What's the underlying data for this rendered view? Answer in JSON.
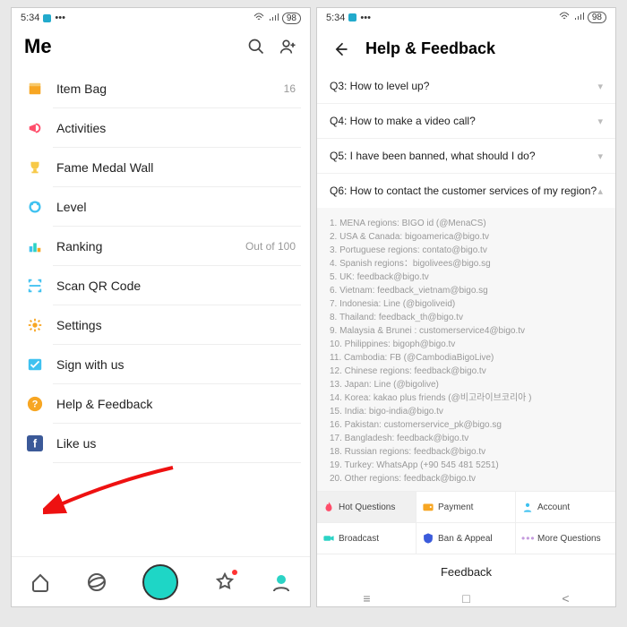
{
  "status": {
    "time": "5:34",
    "battery": "98",
    "dots": "•••"
  },
  "left": {
    "title": "Me",
    "items": [
      {
        "label": "Item Bag",
        "right": "16"
      },
      {
        "label": "Activities",
        "right": ""
      },
      {
        "label": "Fame Medal Wall",
        "right": ""
      },
      {
        "label": "Level",
        "right": ""
      },
      {
        "label": "Ranking",
        "right": "Out of 100"
      },
      {
        "label": "Scan QR Code",
        "right": ""
      },
      {
        "label": "Settings",
        "right": ""
      },
      {
        "label": "Sign with us",
        "right": ""
      },
      {
        "label": "Help & Feedback",
        "right": ""
      },
      {
        "label": "Like us",
        "right": ""
      }
    ]
  },
  "right": {
    "title": "Help & Feedback",
    "questions": [
      "Q3: How to level up?",
      "Q4: How to make a video call?",
      "Q5: I have been banned, what should I do?",
      "Q6: How to contact the customer services of my region?"
    ],
    "answer_lines": [
      "1. MENA regions: BIGO id (@MenaCS)",
      "2. USA & Canada: bigoamerica@bigo.tv",
      "3. Portuguese regions: contato@bigo.tv",
      "4. Spanish regions：bigolivees@bigo.sg",
      "5. UK: feedback@bigo.tv",
      "6. Vietnam: feedback_vietnam@bigo.sg",
      "7. Indonesia: Line (@bigoliveid)",
      "8. Thailand: feedback_th@bigo.tv",
      "9. Malaysia & Brunei : customerservice4@bigo.tv",
      "10. Philippines: bigoph@bigo.tv",
      "11. Cambodia: FB (@CambodiaBigoLive)",
      "12. Chinese regions: feedback@bigo.tv",
      "13. Japan: Line (@bigolive)",
      "14. Korea: kakao plus friends (@비고라이브코리아 )",
      "15. India: bigo-india@bigo.tv",
      "16. Pakistan: customerservice_pk@bigo.sg",
      "17. Bangladesh: feedback@bigo.tv",
      "18. Russian regions: feedback@bigo.tv",
      "19. Turkey: WhatsApp (+90 545 481 5251)",
      "20. Other regions: feedback@bigo.tv"
    ],
    "categories": [
      "Hot Questions",
      "Payment",
      "Account",
      "Broadcast",
      "Ban & Appeal",
      "More Questions"
    ],
    "feedback_label": "Feedback"
  },
  "icons": {
    "colors": {
      "item_bag": "#f7a623",
      "activities": "#ff4d6a",
      "fame": "#f7c948",
      "level": "#3ec1f0",
      "ranking": "#3ec1f0",
      "scan": "#3ec1f0",
      "settings": "#f7a623",
      "sign": "#3ec1f0",
      "help": "#f7a623",
      "like": "#3b5998",
      "hot": "#ff4d6a",
      "payment": "#f7a623",
      "account": "#3ec1f0",
      "broadcast": "#2bd3c5",
      "ban": "#3b5bdb",
      "more": "#c59bde"
    }
  }
}
